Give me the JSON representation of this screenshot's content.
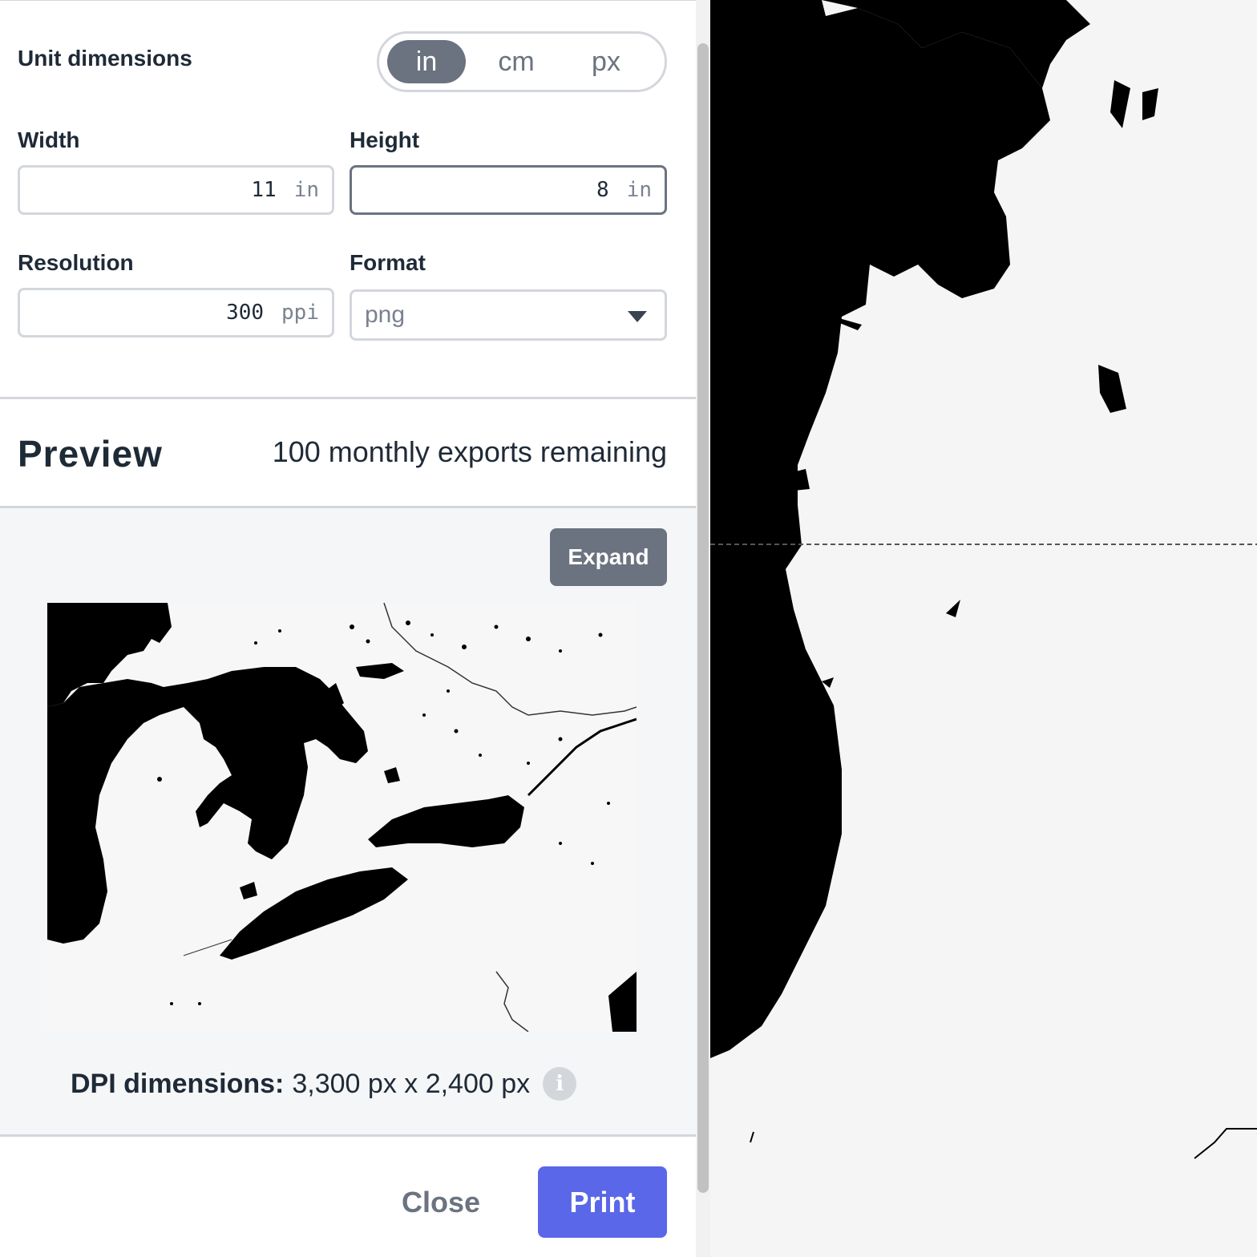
{
  "unit_dimensions": {
    "label": "Unit dimensions",
    "options": [
      "in",
      "cm",
      "px"
    ],
    "selected": "in"
  },
  "width": {
    "label": "Width",
    "value": "11",
    "unit": "in"
  },
  "height": {
    "label": "Height",
    "value": "8",
    "unit": "in"
  },
  "resolution": {
    "label": "Resolution",
    "value": "300",
    "unit": "ppi"
  },
  "format": {
    "label": "Format",
    "value": "png"
  },
  "preview": {
    "title": "Preview",
    "exports_remaining": "100 monthly exports remaining",
    "expand_label": "Expand"
  },
  "dpi": {
    "label": "DPI dimensions:",
    "value": "3,300 px x 2,400 px"
  },
  "actions": {
    "close_label": "Close",
    "print_label": "Print"
  },
  "colors": {
    "accent": "#5a67e8",
    "toggle_active": "#6b7380",
    "map_water": "#000000",
    "map_land": "#f5f5f5"
  }
}
